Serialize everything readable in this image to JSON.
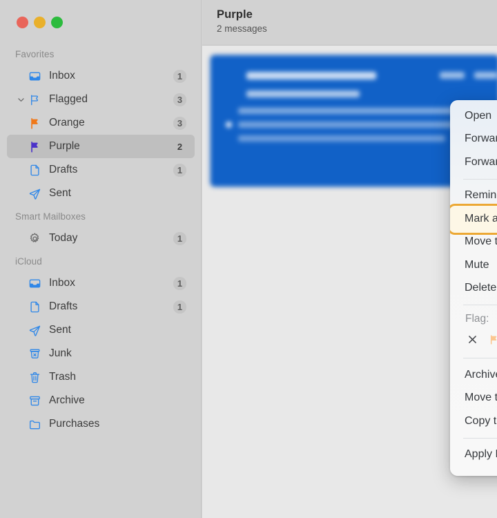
{
  "window": {
    "traffic_lights": [
      {
        "name": "close",
        "color": "#e9655a"
      },
      {
        "name": "minimize",
        "color": "#e9b02b"
      },
      {
        "name": "maximize",
        "color": "#2cbb3d"
      }
    ]
  },
  "sidebar": {
    "sections": [
      {
        "title": "Favorites",
        "items": [
          {
            "label": "Inbox",
            "badge": "1",
            "icon": "inbox-icon",
            "indent": 0,
            "disclosure": "none",
            "selected": false,
            "icon_color": "#2f87e8"
          },
          {
            "label": "Flagged",
            "badge": "3",
            "icon": "flag-outline-icon",
            "indent": 0,
            "disclosure": "expanded",
            "selected": false,
            "icon_color": "#2f87e8"
          },
          {
            "label": "Orange",
            "badge": "3",
            "icon": "flag-solid-icon",
            "indent": 1,
            "disclosure": "none",
            "selected": false,
            "icon_color": "#f07818"
          },
          {
            "label": "Purple",
            "badge": "2",
            "icon": "flag-solid-icon",
            "indent": 1,
            "disclosure": "none",
            "selected": true,
            "icon_color": "#4b32c9"
          },
          {
            "label": "Drafts",
            "badge": "1",
            "icon": "document-icon",
            "indent": 0,
            "disclosure": "none",
            "selected": false,
            "icon_color": "#2f87e8"
          },
          {
            "label": "Sent",
            "badge": "",
            "icon": "paper-plane-icon",
            "indent": 0,
            "disclosure": "none",
            "selected": false,
            "icon_color": "#2f87e8"
          }
        ]
      },
      {
        "title": "Smart Mailboxes",
        "items": [
          {
            "label": "Today",
            "badge": "1",
            "icon": "gear-icon",
            "indent": 0,
            "disclosure": "none",
            "selected": false,
            "icon_color": "#6e6e6e"
          }
        ]
      },
      {
        "title": "iCloud",
        "items": [
          {
            "label": "Inbox",
            "badge": "1",
            "icon": "inbox-icon",
            "indent": 0,
            "disclosure": "none",
            "selected": false,
            "icon_color": "#2f87e8"
          },
          {
            "label": "Drafts",
            "badge": "1",
            "icon": "document-icon",
            "indent": 0,
            "disclosure": "none",
            "selected": false,
            "icon_color": "#2f87e8"
          },
          {
            "label": "Sent",
            "badge": "",
            "icon": "paper-plane-icon",
            "indent": 0,
            "disclosure": "none",
            "selected": false,
            "icon_color": "#2f87e8"
          },
          {
            "label": "Junk",
            "badge": "",
            "icon": "junk-icon",
            "indent": 0,
            "disclosure": "none",
            "selected": false,
            "icon_color": "#2f87e8"
          },
          {
            "label": "Trash",
            "badge": "",
            "icon": "trash-icon",
            "indent": 0,
            "disclosure": "none",
            "selected": false,
            "icon_color": "#2f87e8"
          },
          {
            "label": "Archive",
            "badge": "",
            "icon": "archive-icon",
            "indent": 0,
            "disclosure": "none",
            "selected": false,
            "icon_color": "#2f87e8"
          },
          {
            "label": "Purchases",
            "badge": "",
            "icon": "folder-icon",
            "indent": 0,
            "disclosure": "none",
            "selected": false,
            "icon_color": "#2f87e8"
          }
        ]
      }
    ]
  },
  "main": {
    "title": "Purple",
    "subtitle": "2 messages"
  },
  "context_menu": {
    "items": [
      {
        "type": "item",
        "label": "Open",
        "arrow": false,
        "highlighted": false
      },
      {
        "type": "item",
        "label": "Forward",
        "arrow": false,
        "highlighted": false
      },
      {
        "type": "item",
        "label": "Forward as Attachment",
        "arrow": false,
        "highlighted": false
      },
      {
        "type": "separator"
      },
      {
        "type": "item",
        "label": "Remind Me",
        "arrow": true,
        "highlighted": false
      },
      {
        "type": "item",
        "label": "Mark as Read",
        "arrow": false,
        "highlighted": true
      },
      {
        "type": "item",
        "label": "Move to Junk",
        "arrow": false,
        "highlighted": false
      },
      {
        "type": "item",
        "label": "Mute",
        "arrow": false,
        "highlighted": false
      },
      {
        "type": "item",
        "label": "Delete",
        "arrow": false,
        "highlighted": false
      },
      {
        "type": "separator"
      },
      {
        "type": "flags"
      },
      {
        "type": "separator"
      },
      {
        "type": "item",
        "label": "Archive",
        "arrow": false,
        "highlighted": false
      },
      {
        "type": "item",
        "label": "Move to",
        "arrow": true,
        "highlighted": false
      },
      {
        "type": "item",
        "label": "Copy to",
        "arrow": true,
        "highlighted": false
      },
      {
        "type": "separator"
      },
      {
        "type": "item",
        "label": "Apply Rules",
        "arrow": false,
        "highlighted": false
      }
    ],
    "flag_label": "Flag:",
    "flag_swatches": [
      {
        "name": "no-flag",
        "color": "",
        "selected": false
      },
      {
        "name": "flag-orange",
        "color": "#fbc690",
        "selected": false
      },
      {
        "name": "flag-red",
        "color": "#f9665f",
        "selected": false
      },
      {
        "name": "flag-purple",
        "color": "#7b6df0",
        "selected": true
      },
      {
        "name": "flag-cyan",
        "color": "#93e3ed",
        "selected": false
      },
      {
        "name": "flag-yellow",
        "color": "#fcdd92",
        "selected": false
      },
      {
        "name": "flag-green",
        "color": "#93e6a8",
        "selected": false
      },
      {
        "name": "flag-gray",
        "color": "#c3c7cb",
        "selected": false
      }
    ],
    "highlight_color": "#eca834",
    "highlight_fill": "#fdf7e6"
  }
}
